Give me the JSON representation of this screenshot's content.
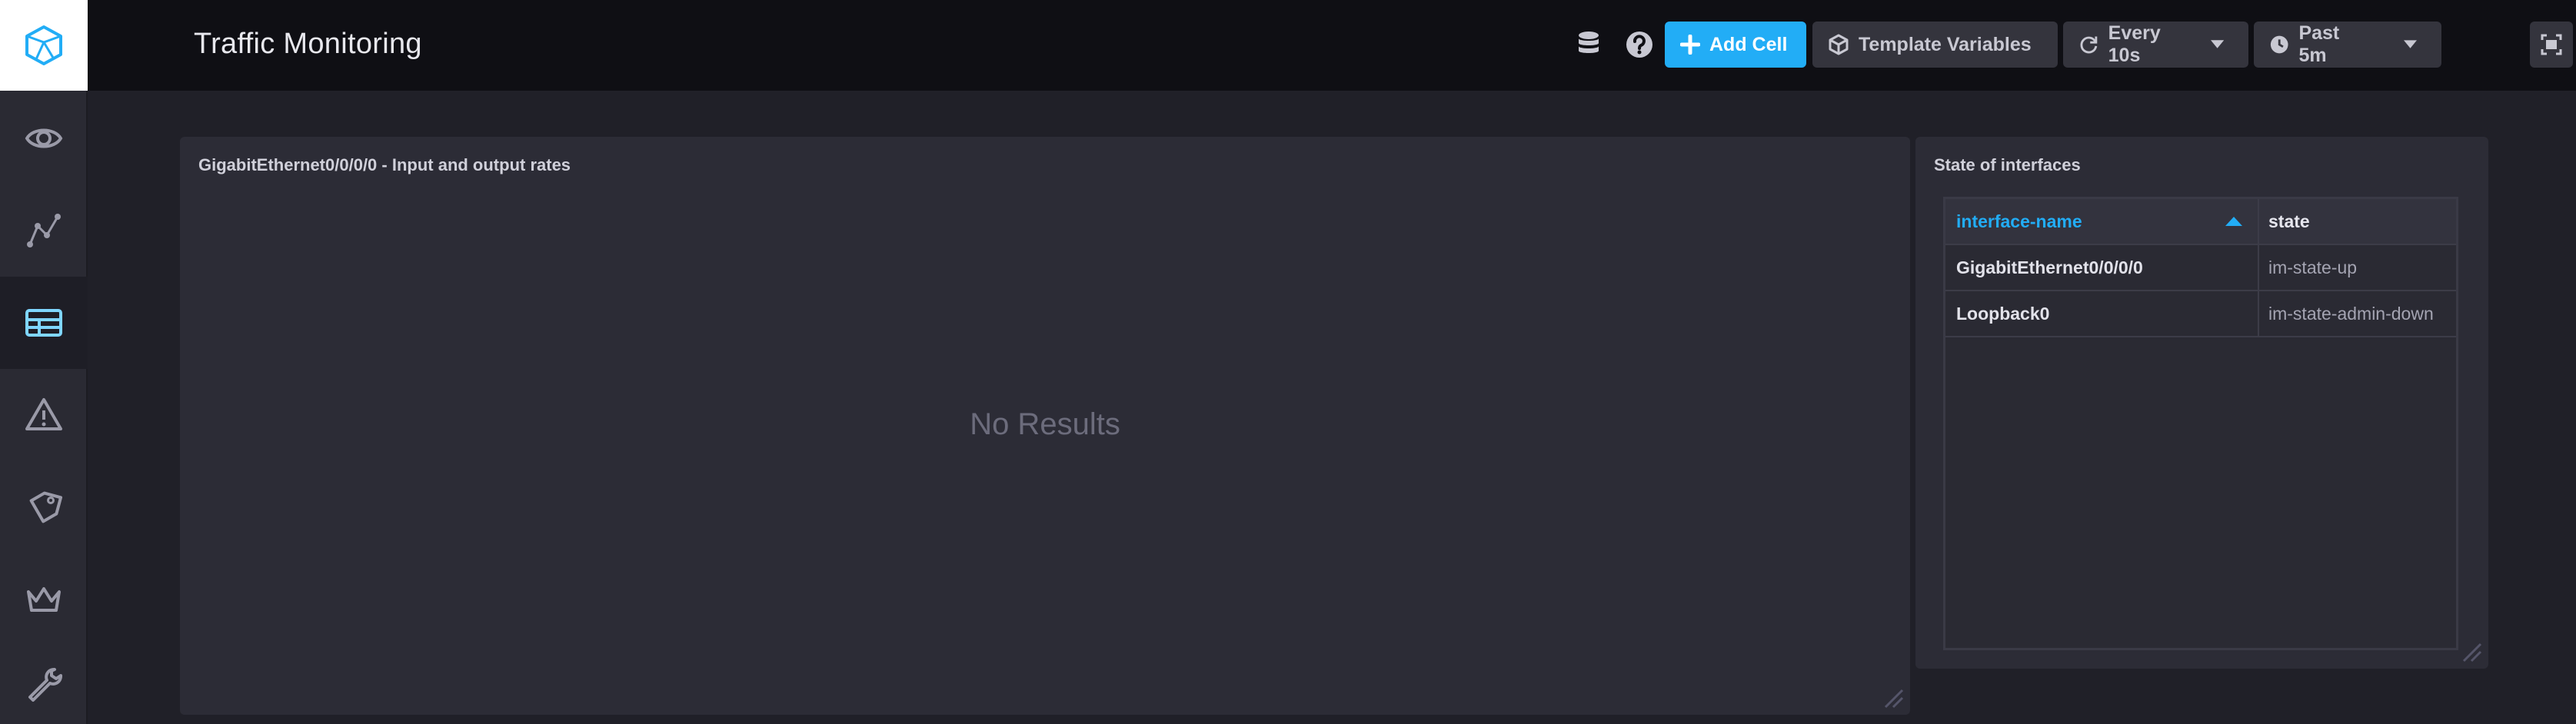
{
  "header": {
    "title": "Traffic Monitoring",
    "add_cell_label": "Add Cell",
    "template_variables_label": "Template Variables",
    "refresh_label": "Every 10s",
    "time_range_label": "Past 5m"
  },
  "sidebar": {
    "items": [
      {
        "icon": "eye-icon"
      },
      {
        "icon": "graph-icon"
      },
      {
        "icon": "dashboards-icon",
        "active": true
      },
      {
        "icon": "alert-icon"
      },
      {
        "icon": "tag-icon"
      },
      {
        "icon": "crown-icon"
      },
      {
        "icon": "wrench-icon"
      }
    ]
  },
  "cells": {
    "graph": {
      "title": "GigabitEthernet0/0/0/0 - Input and output rates",
      "empty_message": "No Results"
    },
    "table": {
      "title": "State of interfaces",
      "columns": [
        "interface-name",
        "state"
      ],
      "rows": [
        {
          "interface_name": "GigabitEthernet0/0/0/0",
          "state": "im-state-up"
        },
        {
          "interface_name": "Loopback0",
          "state": "im-state-admin-down"
        }
      ]
    }
  },
  "colors": {
    "accent": "#22adf6",
    "header_bg": "#0f0f14",
    "sidebar_bg": "#2a2a33",
    "cell_bg": "#2c2c36"
  }
}
